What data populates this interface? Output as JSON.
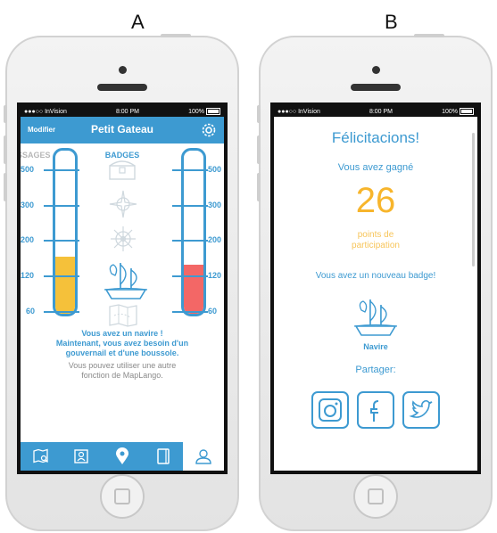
{
  "labels": {
    "a": "A",
    "b": "B"
  },
  "colors": {
    "accent": "#3d9ad1",
    "yellow": "#f5c13a",
    "red": "#f36766",
    "points": "#f7b52c"
  },
  "screen_a": {
    "status": {
      "carrier": "●●●○○ InVision",
      "time": "8:00 PM",
      "battery": "100%"
    },
    "navbar": {
      "modify_label": "Modifier",
      "title": "Petit Gateau",
      "settings_icon": "gear-icon"
    },
    "tabs": {
      "left_partial": "SSAGES",
      "active": "BADGES"
    },
    "scale": [
      "500",
      "300",
      "200",
      "120",
      "60"
    ],
    "left_thermometer_level": 0.35,
    "right_thermometer_level": 0.3,
    "badges": [
      "treasure-chest-icon",
      "compass-rose-icon",
      "ship-wheel-icon",
      "ship-icon",
      "map-icon"
    ],
    "message": [
      "Vous avez un navire !",
      "Maintenant, vous avez besoin d'un",
      "gouvernail et d'une boussole."
    ],
    "secondary_message": [
      "Vous pouvez utiliser une autre",
      "fonction de MapLango."
    ],
    "tabbar": [
      "map-search-icon",
      "profile-card-icon",
      "location-pin-icon",
      "book-icon",
      "user-icon"
    ]
  },
  "screen_b": {
    "status": {
      "carrier": "●●●○○ InVision",
      "time": "8:00 PM",
      "battery": "100%"
    },
    "title": "Félicitacions!",
    "won_label": "Vous avez gagné",
    "points": "26",
    "points_label_1": "points de",
    "points_label_2": "participation",
    "new_badge": "Vous avez un nouveau badge!",
    "badge_name": "Navire",
    "share_label": "Partager:",
    "share_icons": [
      "instagram-icon",
      "facebook-icon",
      "twitter-icon"
    ]
  }
}
